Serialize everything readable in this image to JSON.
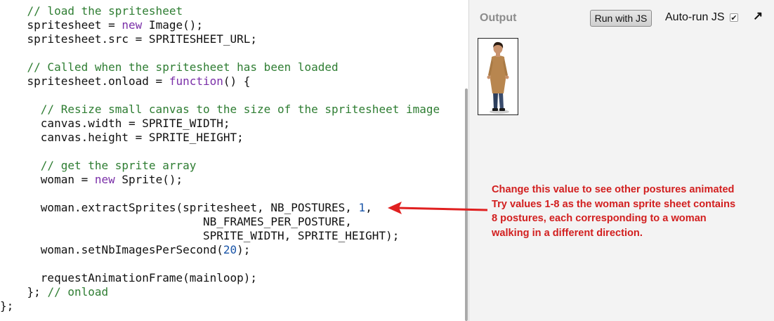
{
  "editor": {
    "lines": [
      [
        {
          "t": "    "
        },
        {
          "t": "// load the spritesheet",
          "c": "c"
        }
      ],
      [
        {
          "t": "    spritesheet = "
        },
        {
          "t": "new",
          "c": "k"
        },
        {
          "t": " Image();"
        }
      ],
      [
        {
          "t": "    spritesheet.src = SPRITESHEET_URL;"
        }
      ],
      [
        {
          "t": ""
        }
      ],
      [
        {
          "t": "    "
        },
        {
          "t": "// Called when the spritesheet has been loaded",
          "c": "c"
        }
      ],
      [
        {
          "t": "    spritesheet.onload = "
        },
        {
          "t": "function",
          "c": "k"
        },
        {
          "t": "() {"
        }
      ],
      [
        {
          "t": ""
        }
      ],
      [
        {
          "t": "      "
        },
        {
          "t": "// Resize small canvas to the size of the spritesheet image",
          "c": "c"
        }
      ],
      [
        {
          "t": "      canvas.width = SPRITE_WIDTH;"
        }
      ],
      [
        {
          "t": "      canvas.height = SPRITE_HEIGHT;"
        }
      ],
      [
        {
          "t": ""
        }
      ],
      [
        {
          "t": "      "
        },
        {
          "t": "// get the sprite array",
          "c": "c"
        }
      ],
      [
        {
          "t": "      woman = "
        },
        {
          "t": "new",
          "c": "k"
        },
        {
          "t": " Sprite();"
        }
      ],
      [
        {
          "t": ""
        }
      ],
      [
        {
          "t": "      woman.extractSprites(spritesheet, NB_POSTURES, "
        },
        {
          "t": "1",
          "c": "n"
        },
        {
          "t": ","
        }
      ],
      [
        {
          "t": "                              NB_FRAMES_PER_POSTURE,"
        }
      ],
      [
        {
          "t": "                              SPRITE_WIDTH, SPRITE_HEIGHT);"
        }
      ],
      [
        {
          "t": "      woman.setNbImagesPerSecond("
        },
        {
          "t": "20",
          "c": "n"
        },
        {
          "t": ");"
        }
      ],
      [
        {
          "t": ""
        }
      ],
      [
        {
          "t": "      requestAnimationFrame(mainloop);"
        }
      ],
      [
        {
          "t": "    }; "
        },
        {
          "t": "// onload",
          "c": "c"
        }
      ],
      [
        {
          "t": "};"
        }
      ]
    ]
  },
  "output": {
    "label": "Output",
    "run_button": "Run with JS",
    "autorun_label": "Auto-run JS",
    "checkbox_mark": "✔",
    "expand_glyph": "↗"
  },
  "annotation": {
    "lines": [
      "Change this value to see other postures animated",
      "Try values 1-8 as the woman sprite sheet contains",
      "8 postures, each corresponding to a woman",
      "walking in a different direction."
    ]
  },
  "colors": {
    "comment": "#2e7d32",
    "keyword": "#7a2fa8",
    "number": "#1a55a8",
    "annotation": "#d21f1f"
  }
}
